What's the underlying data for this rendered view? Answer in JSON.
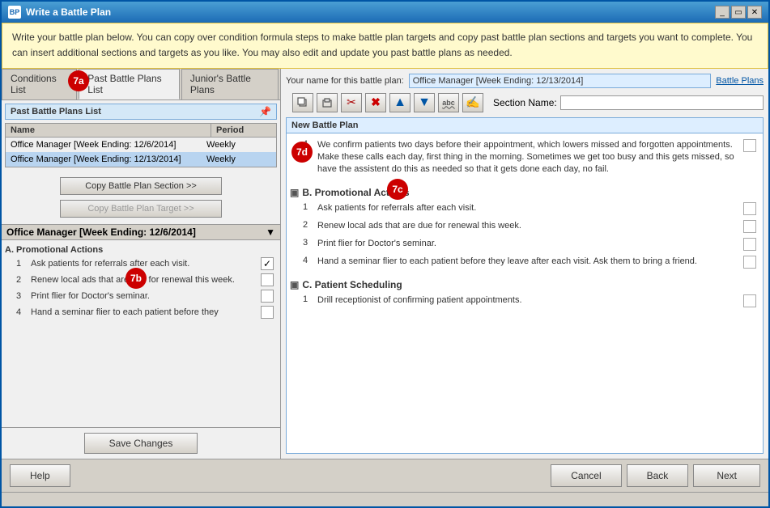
{
  "window": {
    "title": "Write a Battle Plan",
    "icon": "BP"
  },
  "info_banner": "Write your battle plan below. You can copy over condition formula steps to make battle plan targets and copy past battle plan sections and targets you want to complete. You can insert additional sections and targets as you like. You may also edit and update you past battle plans as needed.",
  "tabs": {
    "left": [
      {
        "label": "Conditions List",
        "active": false
      },
      {
        "label": "Past Battle Plans List",
        "active": true
      },
      {
        "label": "Junior's Battle Plans",
        "active": false
      }
    ]
  },
  "past_battle_plans": {
    "panel_title": "Past Battle Plans List",
    "columns": [
      "Name",
      "Period"
    ],
    "rows": [
      {
        "name": "Office Manager [Week Ending: 12/6/2014]",
        "period": "Weekly",
        "selected": true
      },
      {
        "name": "Office Manager [Week Ending: 12/13/2014]",
        "period": "Weekly",
        "selected": false
      }
    ]
  },
  "copy_buttons": {
    "copy_section": "Copy Battle Plan Section >>",
    "copy_target": "Copy Battle Plan Target >>"
  },
  "lower_list": {
    "title": "Office Manager [Week Ending: 12/6/2014]",
    "sections": [
      {
        "label": "A. Promotional Actions",
        "items": [
          {
            "num": 1,
            "text": "Ask patients for referrals after each visit.",
            "checked": true
          },
          {
            "num": 2,
            "text": "Renew local ads that are due for renewal this week.",
            "checked": false
          },
          {
            "num": 3,
            "text": "Print flier for Doctor's seminar.",
            "checked": false
          },
          {
            "num": 4,
            "text": "Hand a seminar flier to each patient before they",
            "checked": false
          }
        ]
      }
    ]
  },
  "save_changes_label": "Save Changes",
  "right_panel": {
    "battle_plan_name_label": "Your name for this battle plan:",
    "battle_plan_name_value": "Office Manager [Week Ending: 12/13/2014]",
    "battle_plans_link": "Battle Plans",
    "section_name_label": "Section Name:",
    "content_header": "New Battle Plan",
    "toolbar_buttons": [
      {
        "icon": "📋",
        "label": "copy-icon"
      },
      {
        "icon": "📄",
        "label": "paste-icon"
      },
      {
        "icon": "✂️",
        "label": "cut-icon"
      },
      {
        "icon": "✖",
        "label": "delete-icon"
      },
      {
        "icon": "⬆",
        "label": "move-up-icon"
      },
      {
        "icon": "⬇",
        "label": "move-down-icon"
      },
      {
        "icon": "ABC",
        "label": "abc-icon"
      },
      {
        "icon": "✍",
        "label": "edit-icon"
      }
    ],
    "sections": [
      {
        "label": "",
        "items": [
          {
            "num": 4,
            "text": "We confirm patients two days before their appointment, which lowers missed and forgotten appointments. Make these calls each day, first thing in the morning. Sometimes we get too busy and this gets missed, so have the assistent do this as needed so that it gets done each day, no fail.",
            "checked": false
          }
        ]
      },
      {
        "label": "B. Promotional Actions",
        "items": [
          {
            "num": 1,
            "text": "Ask patients for referrals after each visit.",
            "checked": false
          },
          {
            "num": 2,
            "text": "Renew local ads that are due for renewal this week.",
            "checked": false
          },
          {
            "num": 3,
            "text": "Print flier for Doctor's seminar.",
            "checked": false
          },
          {
            "num": 4,
            "text": "Hand a seminar flier to each patient before they leave after each visit. Ask them to bring a friend.",
            "checked": false
          }
        ]
      },
      {
        "label": "C. Patient Scheduling",
        "items": [
          {
            "num": 1,
            "text": "Drill receptionist of confirming patient appointments.",
            "checked": false
          }
        ]
      }
    ]
  },
  "bottom_buttons": {
    "help": "Help",
    "cancel": "Cancel",
    "back": "Back",
    "next": "Next"
  },
  "annotations": {
    "a7a": "7a",
    "a7b": "7b",
    "a7c": "7c",
    "a7d": "7d"
  },
  "status_bar": {
    "text": ""
  }
}
